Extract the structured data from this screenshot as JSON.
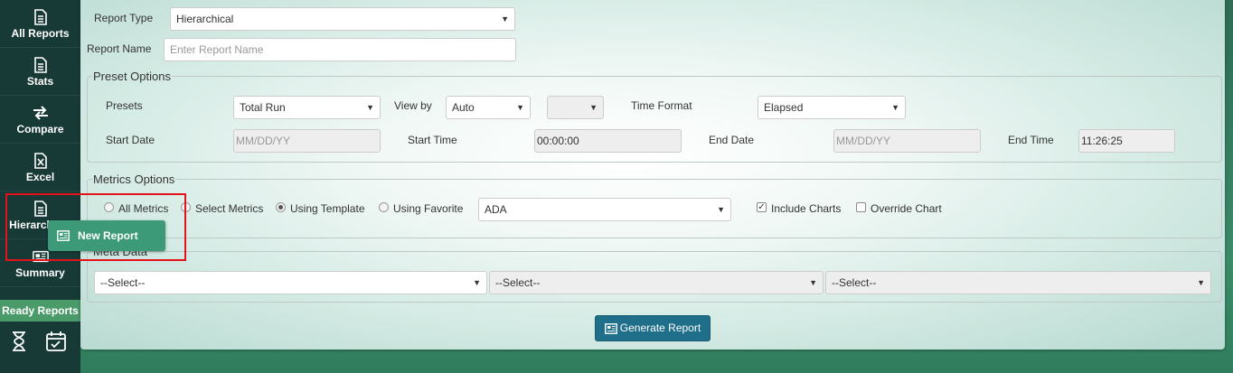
{
  "sidebar": {
    "items": [
      {
        "label": "All Reports",
        "icon": "document-icon"
      },
      {
        "label": "Stats",
        "icon": "document-icon"
      },
      {
        "label": "Compare",
        "icon": "swap-arrows-icon"
      },
      {
        "label": "Excel",
        "icon": "excel-icon"
      },
      {
        "label": "Hierarchical",
        "icon": "document-icon"
      },
      {
        "label": "Summary",
        "icon": "newspaper-icon"
      }
    ],
    "ready_reports": "Ready Reports",
    "bottom_icons": [
      "hourglass-icon",
      "calendar-check-icon"
    ]
  },
  "popover": {
    "label": "New Report",
    "icon": "newspaper-icon"
  },
  "form": {
    "report_type_label": "Report Type",
    "report_type_value": "Hierarchical",
    "report_name_label": "Report Name",
    "report_name_placeholder": "Enter Report Name"
  },
  "preset": {
    "legend": "Preset Options",
    "presets_label": "Presets",
    "presets_value": "Total Run",
    "view_by_label": "View by",
    "view_by_value": "Auto",
    "view_by_sub_value": "",
    "time_format_label": "Time Format",
    "time_format_value": "Elapsed",
    "start_date_label": "Start Date",
    "start_date_placeholder": "MM/DD/YY",
    "start_time_label": "Start Time",
    "start_time_value": "00:00:00",
    "end_date_label": "End Date",
    "end_date_placeholder": "MM/DD/YY",
    "end_time_label": "End Time",
    "end_time_value": "11:26:25"
  },
  "metrics": {
    "legend": "Metrics Options",
    "radios": [
      {
        "label": "All Metrics",
        "checked": false
      },
      {
        "label": "Select Metrics",
        "checked": false
      },
      {
        "label": "Using Template",
        "checked": true
      },
      {
        "label": "Using Favorite",
        "checked": false
      }
    ],
    "template_value": "ADA",
    "include_charts_label": "Include Charts",
    "include_charts_checked": true,
    "override_chart_label": "Override Chart",
    "override_chart_checked": false
  },
  "meta": {
    "legend": "Meta Data",
    "selects": [
      "--Select--",
      "--Select--",
      "--Select--"
    ]
  },
  "generate_label": "Generate Report",
  "colors": {
    "sidebar_bg": "#173a36",
    "accent_button": "#1f6e8a",
    "popover_bg": "#3c9a78",
    "highlight_border": "#e3121b",
    "ready_bg": "#4a9a6a"
  }
}
